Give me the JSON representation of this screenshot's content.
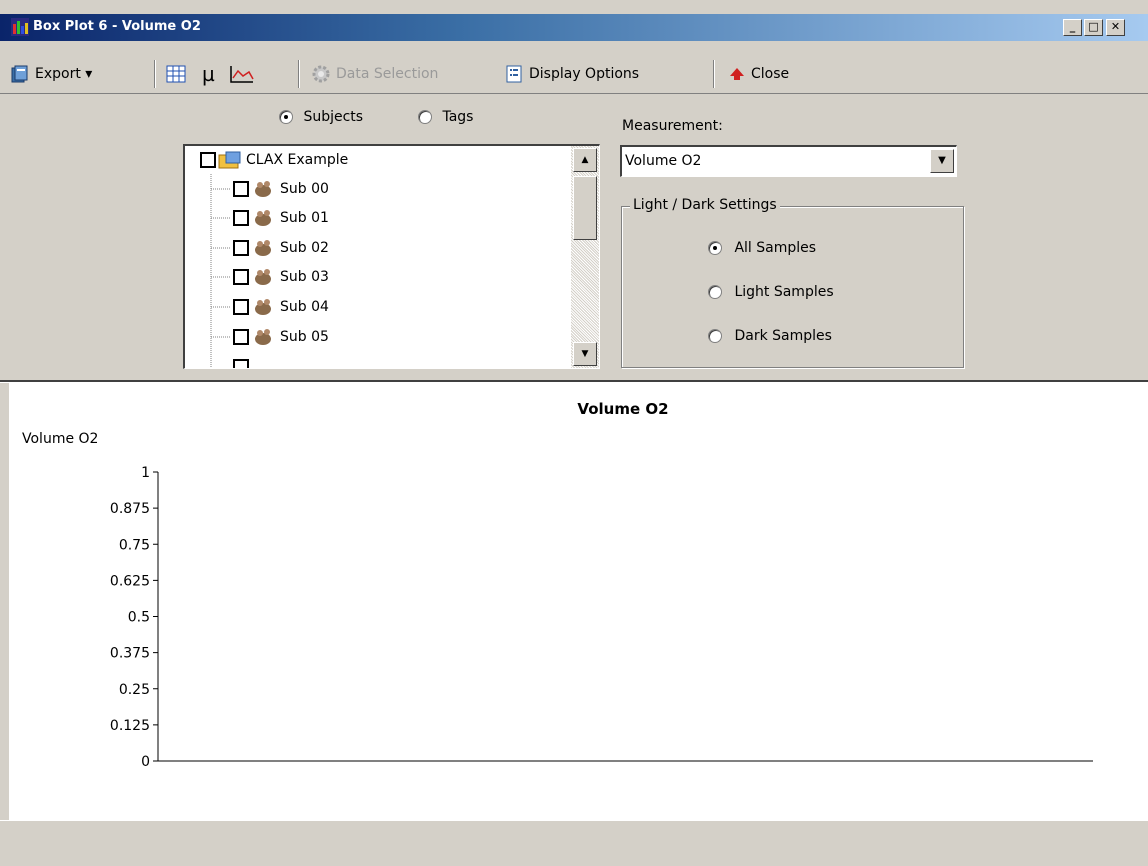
{
  "window": {
    "title": "Box Plot 6 - Volume O2",
    "controls": [
      "_",
      "□",
      "✕"
    ]
  },
  "toolbar": {
    "export_label": "Export ▾",
    "data_selection_label": "Data Selection",
    "display_options_label": "Display Options",
    "close_label": "Close",
    "mu_glyph": "µ"
  },
  "selection": {
    "subjects_label": "Subjects",
    "tags_label": "Tags",
    "mode_selected": "Subjects",
    "tree": {
      "root": "CLAX Example",
      "items": [
        "Sub 00",
        "Sub 01",
        "Sub 02",
        "Sub 03",
        "Sub 04",
        "Sub 05"
      ]
    }
  },
  "measurement": {
    "label": "Measurement:",
    "value": "Volume O2"
  },
  "light_dark": {
    "legend": "Light / Dark Settings",
    "options": [
      "All Samples",
      "Light Samples",
      "Dark Samples"
    ],
    "selected": "All Samples"
  },
  "chart_data": {
    "type": "box",
    "title": "Volume O2",
    "ylabel": "Volume O2",
    "xlabel": "",
    "ylim": [
      0,
      1
    ],
    "yticks": [
      "1",
      "0.875",
      "0.75",
      "0.625",
      "0.5",
      "0.375",
      "0.25",
      "0.125",
      "0"
    ],
    "series": []
  }
}
